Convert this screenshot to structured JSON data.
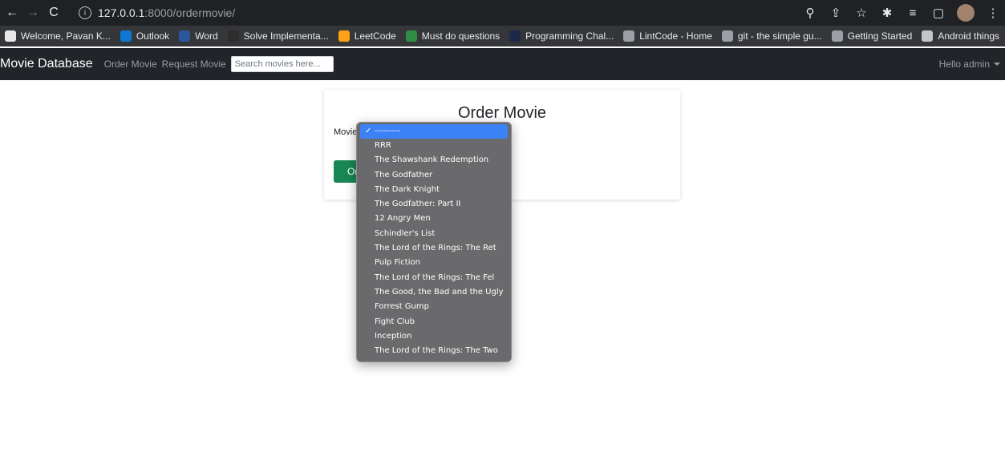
{
  "browser": {
    "url_host": "127.0.0.1",
    "url_path": ":8000/ordermovie/"
  },
  "bookmarks": [
    {
      "label": "Welcome, Pavan K...",
      "color": "#e8e8e8"
    },
    {
      "label": "Outlook",
      "color": "#0f78d4"
    },
    {
      "label": "Word",
      "color": "#2b579a"
    },
    {
      "label": "Solve Implementa...",
      "color": "#2d2d2d"
    },
    {
      "label": "LeetCode",
      "color": "#ffa116"
    },
    {
      "label": "Must do questions",
      "color": "#2f8d46"
    },
    {
      "label": "Programming Chal...",
      "color": "#1c2a4a"
    },
    {
      "label": "LintCode - Home",
      "color": "#9aa0a6"
    },
    {
      "label": "git - the simple gu...",
      "color": "#9aa0a6"
    },
    {
      "label": "Getting Started",
      "color": "#9aa0a6"
    },
    {
      "label": "Android things",
      "color": "#c4c7c5"
    }
  ],
  "bookmarks_more": "»",
  "navbar": {
    "brand": "Movie Database",
    "links": [
      "Order Movie",
      "Request Movie"
    ],
    "search_placeholder": "Search movies here...",
    "user_greeting": "Hello admin"
  },
  "card": {
    "title": "Order Movie",
    "field_label": "Movie",
    "button_label": "Or"
  },
  "dropdown": {
    "selected": "---------",
    "options": [
      "---------",
      "RRR",
      "The Shawshank Redemption",
      "The Godfather",
      "The Dark Knight",
      "The Godfather: Part II",
      "12 Angry Men",
      "Schindler's List",
      "The Lord of the Rings: The Ret",
      "Pulp Fiction",
      "The Lord of the Rings: The Fel",
      "The Good, the Bad and the Ugly",
      "Forrest Gump",
      "Fight Club",
      "Inception",
      "The Lord of the Rings: The Two"
    ]
  },
  "colors": {
    "accent": "#3b82f6",
    "success": "#198754",
    "navbar_bg": "#212529"
  }
}
